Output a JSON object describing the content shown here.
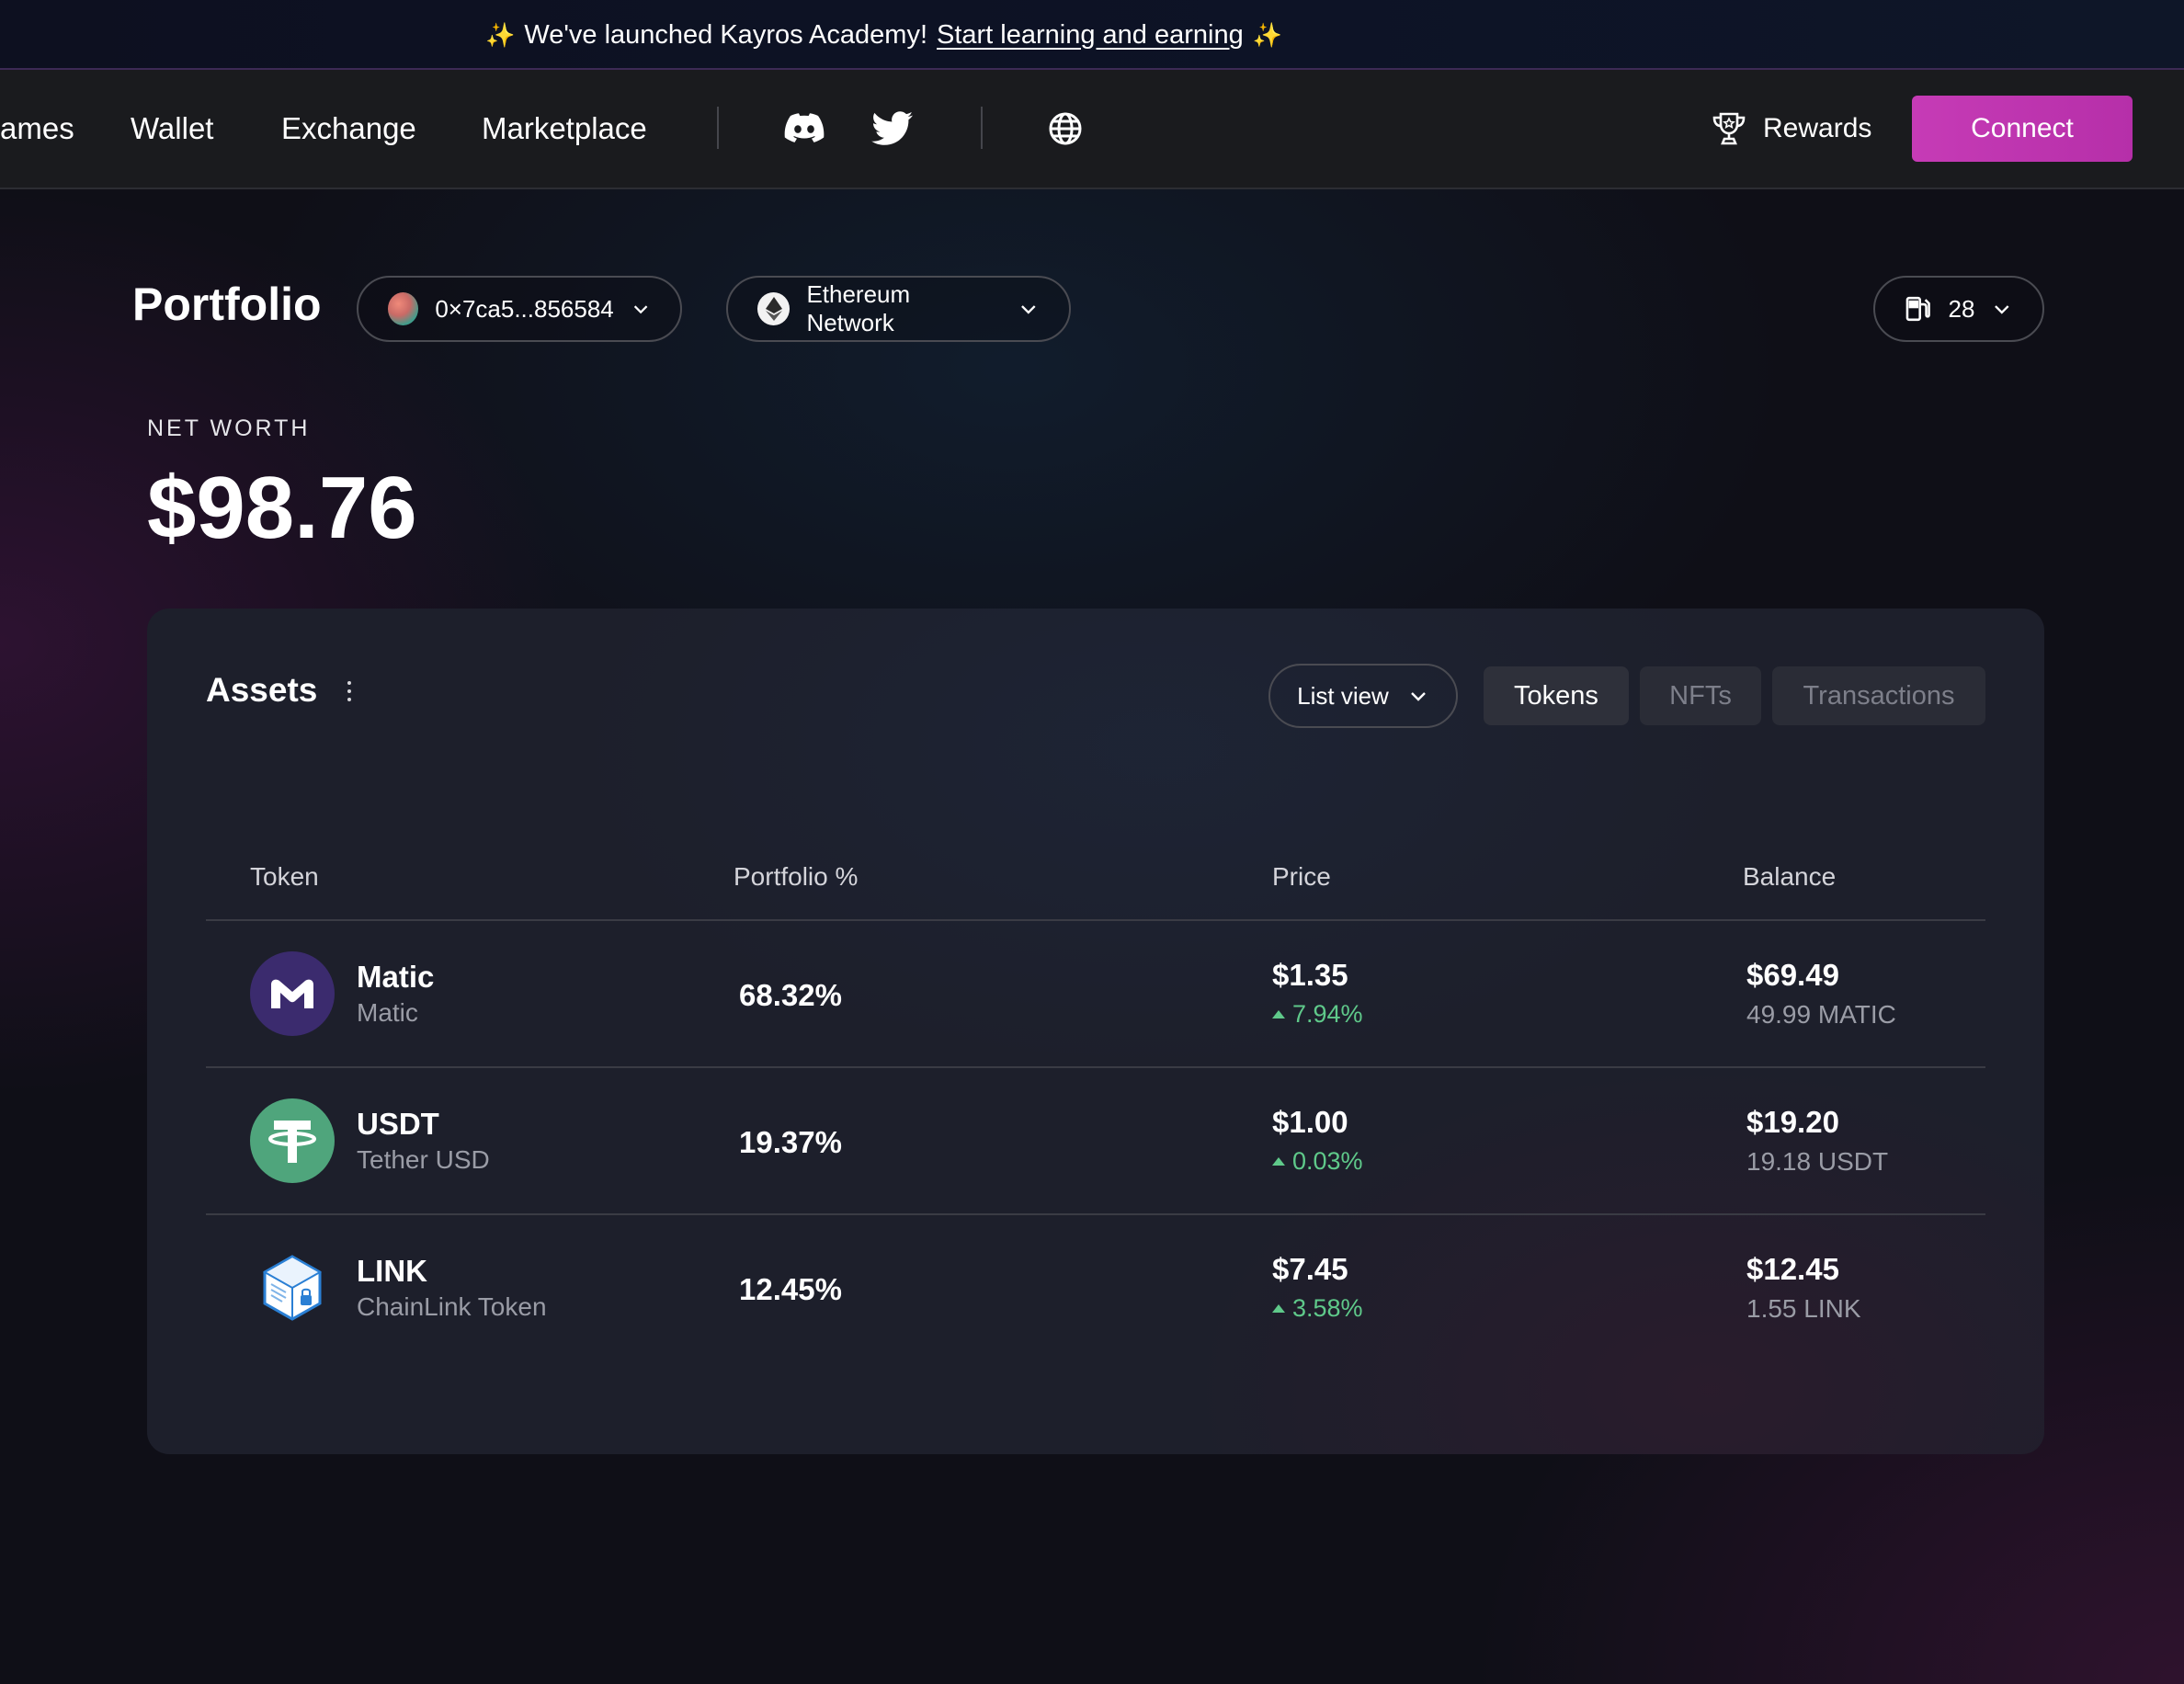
{
  "announcement": {
    "sparkle": "✨",
    "text": "We've launched Kayros Academy!",
    "link": "Start learning and earning"
  },
  "nav": {
    "items": [
      "ames",
      "Wallet",
      "Exchange",
      "Marketplace"
    ],
    "rewards_label": "Rewards",
    "connect_label": "Connect"
  },
  "portfolio": {
    "title": "Portfolio",
    "address": "0×7ca5...856584",
    "network": "Ethereum Network",
    "gas": "28",
    "net_worth_label": "NET WORTH",
    "net_worth_value": "$98.76"
  },
  "assets": {
    "title": "Assets",
    "view_label": "List view",
    "tabs": [
      {
        "label": "Tokens",
        "active": true
      },
      {
        "label": "NFTs",
        "active": false
      },
      {
        "label": "Transactions",
        "active": false
      }
    ],
    "columns": [
      "Token",
      "Portfolio %",
      "Price",
      "Balance"
    ],
    "rows": [
      {
        "symbol": "Matic",
        "name": "Matic",
        "portfolio_pct": "68.32%",
        "price": "$1.35",
        "change": "7.94%",
        "balance_usd": "$69.49",
        "balance_amount": "49.99 MATIC",
        "icon": "matic-icon",
        "icon_color": "#3b2b6e"
      },
      {
        "symbol": "USDT",
        "name": "Tether USD",
        "portfolio_pct": "19.37%",
        "price": "$1.00",
        "change": "0.03%",
        "balance_usd": "$19.20",
        "balance_amount": "19.18 USDT",
        "icon": "tether-icon",
        "icon_color": "#4fa57c"
      },
      {
        "symbol": "LINK",
        "name": "ChainLink Token",
        "portfolio_pct": "12.45%",
        "price": "$7.45",
        "change": "3.58%",
        "balance_usd": "$12.45",
        "balance_amount": "1.55 LINK",
        "icon": "chainlink-icon",
        "icon_color": "#2a7fd4"
      }
    ]
  },
  "colors": {
    "accent": "#c63bb6",
    "positive": "#5fc98a",
    "card_bg": "#1d1f2b",
    "navbar_bg": "#1a1b1e"
  }
}
